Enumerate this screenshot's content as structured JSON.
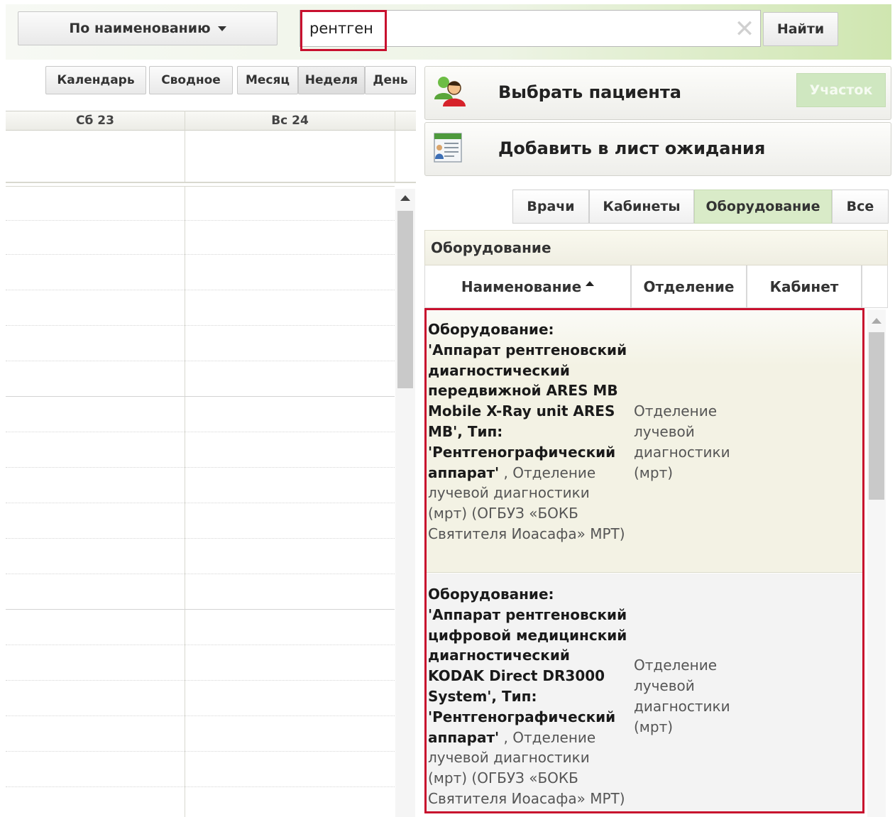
{
  "search": {
    "mode_label": "По наименованию",
    "query": "рентген",
    "clear_glyph": "✕",
    "find_label": "Найти"
  },
  "calendar": {
    "views": [
      {
        "label": "Календарь"
      },
      {
        "label": "Сводное"
      },
      {
        "label": "Месяц"
      },
      {
        "label": "Неделя",
        "active": true
      },
      {
        "label": "День"
      }
    ],
    "days": [
      "Сб 23",
      "Вс 24"
    ]
  },
  "panel": {
    "select_patient": "Выбрать пациента",
    "uchastok": "Участок",
    "add_waitlist": "Добавить в лист ожидания"
  },
  "tabs": [
    {
      "label": "Врачи"
    },
    {
      "label": "Кабинеты"
    },
    {
      "label": "Оборудование",
      "active": true
    },
    {
      "label": "Все"
    }
  ],
  "equipment": {
    "section_title": "Оборудование",
    "columns": [
      "Наименование",
      "Отделение",
      "Кабинет"
    ],
    "rows": [
      {
        "name_bold": "Оборудование: 'Аппарат рентгеновский диагностический передвижной ARES MB Mobile X-Ray unit ARES MB', Тип: 'Рентгенографический аппарат'",
        "name_light": " , Отделение лучевой диагностики (мрт) (ОГБУЗ «БОКБ Святителя Иоасафа» МРТ)",
        "department": "Отделение лучевой диагностики (мрт)",
        "cabinet": ""
      },
      {
        "name_bold": "Оборудование: 'Аппарат рентгеновский цифровой медицинский диагностический KODAK Direct DR3000 System', Тип: 'Рентгенографический аппарат'",
        "name_light": " , Отделение лучевой диагностики (мрт) (ОГБУЗ «БОКБ Святителя Иоасафа» МРТ)",
        "department": "Отделение лучевой диагностики (мрт)",
        "cabinet": ""
      }
    ]
  },
  "colors": {
    "accent_green": "#d9ebc8",
    "highlight_red": "#c8102e"
  }
}
